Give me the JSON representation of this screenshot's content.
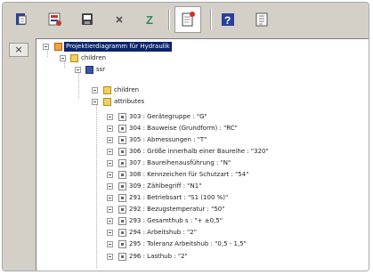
{
  "toolbar": {
    "buttons": [
      {
        "name": "toolbar-button-1-icon",
        "glyph": "▐"
      },
      {
        "name": "toolbar-button-2-icon",
        "glyph": "▦"
      },
      {
        "name": "toolbar-button-3-icon",
        "glyph": "▣"
      },
      {
        "name": "delete-icon",
        "glyph": "×"
      },
      {
        "name": "z-icon",
        "glyph": "Z"
      },
      {
        "name": "new-document-icon",
        "glyph": "◫"
      },
      {
        "name": "help-icon",
        "glyph": "?"
      },
      {
        "name": "info-icon",
        "glyph": "▤"
      }
    ]
  },
  "side": {
    "close_label": "×"
  },
  "tree": {
    "root_label": "Projektierdiagramm für Hydraulik",
    "children_label": "children",
    "ssr_label": "ssr",
    "sub_children_label": "children",
    "attributes_label": "attributes",
    "attributes": [
      "303 : Gerätegruppe : \"G\"",
      "304 : Bauweise (Grundform) : \"RC\"",
      "305 : Abmessungen : \"T\"",
      "306 : Größe innerhalb einer Baureihe : \"320\"",
      "307 : Baureihenausführung : \"N\"",
      "308 : Kennzeichen für Schutzart : \"54\"",
      "309 : Zählbegriff : \"N1\"",
      "291 : Betriebsart : \"S1 (100 %)\"",
      "292 : Bezugstemperatur : \"50\"",
      "293 : Gesamthub s : \"+ ±0,5\"",
      "294 : Arbeitshub : \"2\"",
      "295 : Toleranz Arbeitshub : \"0,5 - 1,5\"",
      "296 : Lasthub : \"2\""
    ]
  }
}
